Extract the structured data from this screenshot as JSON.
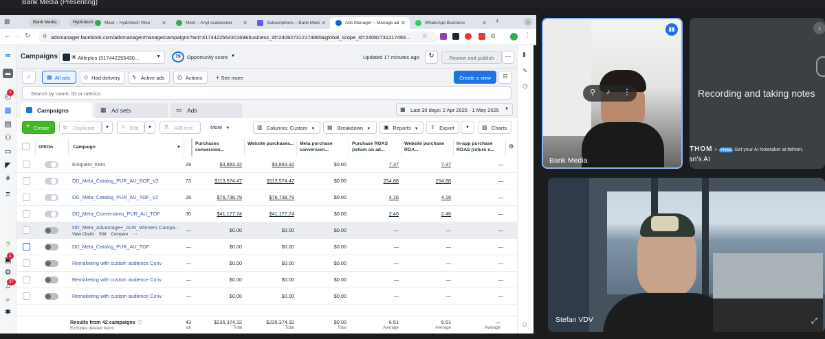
{
  "meet": {
    "presenting_title": "Bank Media (Presenting)",
    "tile_bank_media": "Bank Media",
    "tile_stefans_ai": "Stefan's AI",
    "tile_stefan_vdv": "Stefan VDV",
    "recording_text": "Recording and taking notes",
    "thom_brand": "THOM",
    "thom_free": "FREE",
    "thom_tagline": "Get your AI Notetaker at fathom."
  },
  "browser": {
    "groups": [
      {
        "label": "Bank Media",
        "color": "#d2d5db"
      },
      {
        "label": "Hydrotech",
        "color": "#d2d5db"
      }
    ],
    "tabs": [
      {
        "title": "Meet – Hydrotech Wee",
        "icon": "meet-icon",
        "color": "#34a853"
      },
      {
        "title": "Meet – Anyt scaleeeeer",
        "icon": "meet-icon",
        "color": "#34a853"
      },
      {
        "title": "Subscriptions – Bank Medi",
        "icon": "subscriptions-icon",
        "color": "#635bff"
      },
      {
        "title": "Ads Manager – Manage ad",
        "icon": "meta-icon",
        "color": "#0668e1"
      },
      {
        "title": "WhatsApp Business",
        "icon": "whatsapp-icon",
        "color": "#25d366"
      }
    ],
    "url": "adsmanager.facebook.com/adsmanager/manage/campaigns?act=317442255430169&business_id=240827312174965&global_scope_id=24082731217493..."
  },
  "ads": {
    "header": {
      "title": "Campaigns",
      "account": "Alifeplus (317442255430...",
      "opportunity_score": "79",
      "opportunity_label": "Opportunity score",
      "updated": "Updated 17 minutes ago",
      "review_publish": "Review and publish"
    },
    "filters": {
      "all_ads": "All ads",
      "had_delivery": "Had delivery",
      "active_ads": "Active ads",
      "actions": "Actions",
      "see_more": "See more",
      "create_view": "Create a view"
    },
    "search_placeholder": "Search by name, ID or metrics",
    "level_tabs": {
      "campaigns": "Campaigns",
      "ad_sets": "Ad sets",
      "ads": "Ads"
    },
    "date_range": "Last 30 days: 2 Apr 2025 - 1 May 2025",
    "toolbar": {
      "create": "Create",
      "duplicate": "Duplicate",
      "edit": "Edit",
      "ab_test": "A/B test",
      "more": "More",
      "columns": "Columns: Custom",
      "breakdown": "Breakdown",
      "reports": "Reports",
      "export": "Export",
      "charts": "Charts"
    },
    "columns": [
      "Off/On",
      "Campaign",
      "Purchases conversion...",
      "Website purchases...",
      "Meta purchase conversion...",
      "Purchase ROAS (return on ad...",
      "Website purchase ROA...",
      "In-app purchase ROAS (return o..."
    ],
    "rows": [
      {
        "on": true,
        "name": "Eloquent_Keto",
        "trunc": "29",
        "c1": "$3,883.32",
        "c2": "$3,883.32",
        "c3": "$0.00",
        "c4": "7.37",
        "c5": "7.37",
        "c6": "—"
      },
      {
        "on": true,
        "name": "DD_Meta_Catalog_PUR_AU_BOF_V2",
        "trunc": "73",
        "c1": "$113,574.47",
        "c2": "$113,574.47",
        "c3": "$0.00",
        "c4": "254.88",
        "c5": "254.88",
        "c6": "—"
      },
      {
        "on": true,
        "name": "DD_Meta_Catalog_PUR_AU_TOF_V2",
        "trunc": "28",
        "c1": "$76,738.79",
        "c2": "$76,738.79",
        "c3": "$0.00",
        "c4": "4.16",
        "c5": "4.16",
        "c6": "—"
      },
      {
        "on": true,
        "name": "DD_Meta_Conversions_PUR_AU_TOF",
        "trunc": "30",
        "c1": "$41,177.74",
        "c2": "$41,177.74",
        "c3": "$0.00",
        "c4": "2.46",
        "c5": "2.46",
        "c6": "—"
      },
      {
        "on": false,
        "name": "DD_Meta_Advantage+_AUS_Winners Campa...",
        "trunc": "—",
        "c1": "$0.00",
        "c2": "$0.00",
        "c3": "$0.00",
        "c4": "—",
        "c5": "—",
        "c6": "—",
        "hover": true,
        "hover_actions": [
          "View Charts",
          "Edit",
          "Compare"
        ]
      },
      {
        "on": false,
        "name": "DD_Meta_Catalog_PUR_AU_TOF",
        "trunc": "—",
        "c1": "$0.00",
        "c2": "$0.00",
        "c3": "$0.00",
        "c4": "—",
        "c5": "—",
        "c6": "—"
      },
      {
        "on": false,
        "name": "Remaketing with custom audience Conv",
        "trunc": "—",
        "c1": "$0.00",
        "c2": "$0.00",
        "c3": "$0.00",
        "c4": "—",
        "c5": "—",
        "c6": "—"
      },
      {
        "on": false,
        "name": "Remaketing with custom audience Conv",
        "trunc": "—",
        "c1": "$0.00",
        "c2": "$0.00",
        "c3": "$0.00",
        "c4": "—",
        "c5": "—",
        "c6": "—"
      },
      {
        "on": false,
        "name": "Remaketing with custom audience Conv",
        "trunc": "—",
        "c1": "$0.00",
        "c2": "$0.00",
        "c3": "$0.00",
        "c4": "—",
        "c5": "—",
        "c6": "—"
      }
    ],
    "footer": {
      "results": "Results from 42 campaigns",
      "excludes": "Excludes deleted items",
      "trunc": "43",
      "trunc_sub": "ick",
      "c1": "$235,374.32",
      "c2": "$235,374.32",
      "c3": "$0.00",
      "c4": "6.51",
      "c5": "6.51",
      "c6": "—",
      "total": "Total",
      "average": "Average"
    },
    "badges": {
      "notif1": "1",
      "notif2": "1",
      "notif3": "37"
    }
  }
}
